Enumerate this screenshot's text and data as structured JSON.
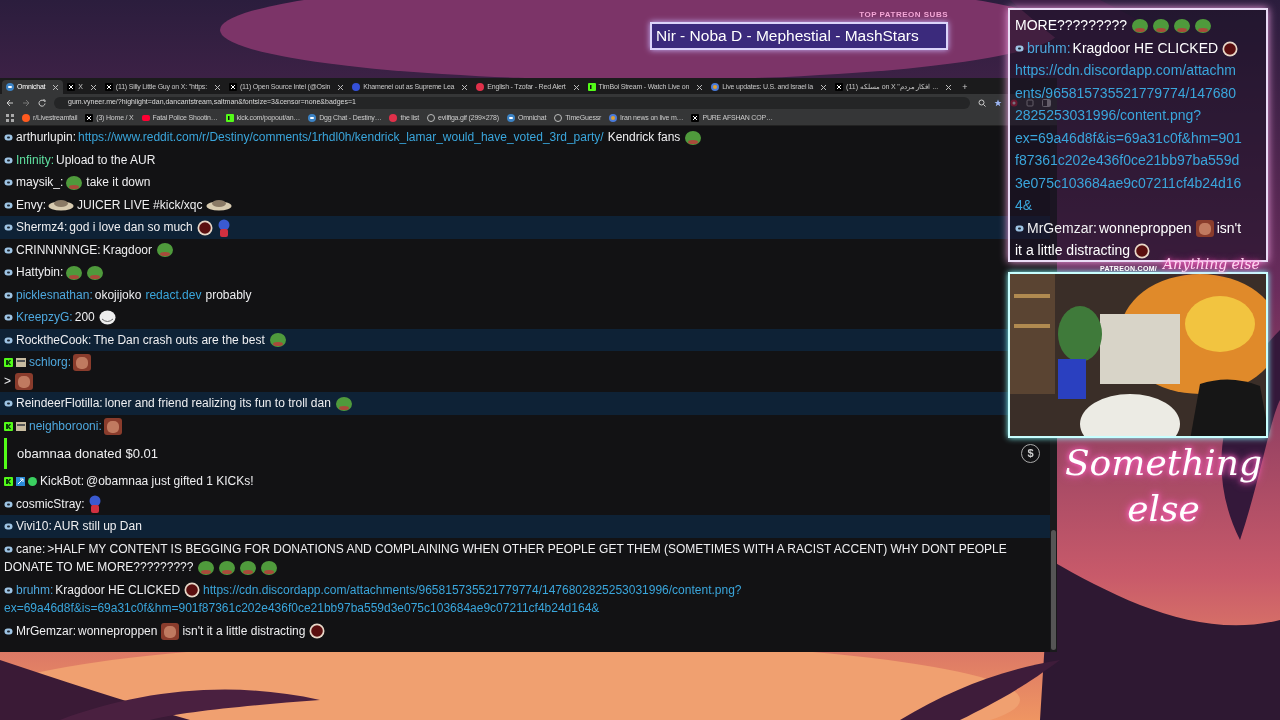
{
  "patreon_subs": {
    "label": "TOP PATREON SUBS",
    "names": "Nir - Noba D - Mephestial - MashStars"
  },
  "browser": {
    "tabs": [
      {
        "title": "Omnichat",
        "kind": "chat",
        "selected": true
      },
      {
        "title": "X",
        "kind": "x",
        "selected": false
      },
      {
        "title": "(11) Silly Little Guy on X: \"https:",
        "kind": "x",
        "selected": false
      },
      {
        "title": "(11) Open Source Intel (@Osin",
        "kind": "x",
        "selected": false
      },
      {
        "title": "Khamenei out as Supreme Lea",
        "kind": "circle",
        "selected": false
      },
      {
        "title": "English - Tzofar - Red Alert",
        "kind": "alert",
        "selected": false
      },
      {
        "title": "TimBoi Stream - Watch Live on",
        "kind": "kick",
        "selected": false
      },
      {
        "title": "Live updates: U.S. and Israel la",
        "kind": "news",
        "selected": false
      },
      {
        "title": "(11) مسلکه on X \"افکار مردم ...",
        "kind": "x",
        "selected": false
      }
    ],
    "new_tab": "+",
    "url": "gum.vyneer.me/?highlight=dan,dancantstream,saltman&fontsize=3&censor=none&badges=1",
    "bookmarks": [
      {
        "title": "r/Livestreamfail",
        "kind": "reddit"
      },
      {
        "title": "(3) Home / X",
        "kind": "x"
      },
      {
        "title": "Fatal Police Shootin…",
        "kind": "video"
      },
      {
        "title": "kick.com/popout/an…",
        "kind": "kick"
      },
      {
        "title": "Dgg Chat - Destiny…",
        "kind": "chat"
      },
      {
        "title": "the list",
        "kind": "alert"
      },
      {
        "title": "evilfiga.gif (299×278)",
        "kind": "globe"
      },
      {
        "title": "Omnichat",
        "kind": "chat"
      },
      {
        "title": "TimeGuessr",
        "kind": "globe"
      },
      {
        "title": "Iran news on live m…",
        "kind": "news"
      },
      {
        "title": "PURE AFSHAN COP…",
        "kind": "x"
      }
    ]
  },
  "chat": {
    "messages": [
      {
        "kind": "message",
        "badges": [
          {
            "kind": "chat"
          }
        ],
        "user": "arthurlupin:",
        "color": "#efeff1",
        "highlighted": false,
        "parts": [
          {
            "kind": "link",
            "text": "https://www.reddit.com/r/Destiny/comments/1rhdl0h/kendrick_lamar_would_have_voted_3rd_party/"
          },
          {
            "kind": "text",
            "text": "Kendrick fans"
          },
          {
            "kind": "frog"
          }
        ]
      },
      {
        "kind": "message",
        "badges": [
          {
            "kind": "chat"
          }
        ],
        "user": "Infinity:",
        "color": "#5fe0a0",
        "highlighted": false,
        "parts": [
          {
            "kind": "text",
            "text": "Upload to the AUR"
          }
        ]
      },
      {
        "kind": "message",
        "badges": [
          {
            "kind": "chat"
          }
        ],
        "user": "maysik_:",
        "color": "#efeff1",
        "highlighted": false,
        "parts": [
          {
            "kind": "frog"
          },
          {
            "kind": "text",
            "text": "take it down"
          }
        ]
      },
      {
        "kind": "message",
        "badges": [
          {
            "kind": "chat"
          }
        ],
        "user": "Envy:",
        "color": "#efeff1",
        "highlighted": false,
        "parts": [
          {
            "kind": "bowl"
          },
          {
            "kind": "text",
            "text": "JUICER LIVE #kick/xqc"
          },
          {
            "kind": "bowl"
          }
        ]
      },
      {
        "kind": "message",
        "badges": [
          {
            "kind": "chat"
          }
        ],
        "user": "Shermz4:",
        "color": "#efeff1",
        "highlighted": true,
        "parts": [
          {
            "kind": "text",
            "text": "god i love dan so much"
          },
          {
            "kind": "ball"
          },
          {
            "kind": "doll"
          }
        ]
      },
      {
        "kind": "message",
        "badges": [
          {
            "kind": "chat"
          }
        ],
        "user": "CRINNNNNGE:",
        "color": "#efeff1",
        "highlighted": false,
        "parts": [
          {
            "kind": "text",
            "text": "Kragdoor"
          },
          {
            "kind": "frog"
          }
        ]
      },
      {
        "kind": "message",
        "badges": [
          {
            "kind": "chat"
          }
        ],
        "user": "Hattybin:",
        "color": "#efeff1",
        "highlighted": false,
        "parts": [
          {
            "kind": "frog"
          },
          {
            "kind": "frog"
          }
        ]
      },
      {
        "kind": "message",
        "badges": [
          {
            "kind": "chat"
          }
        ],
        "user": "picklesnathan:",
        "color": "#4ea8de",
        "highlighted": false,
        "parts": [
          {
            "kind": "text",
            "text": "okojijoko"
          },
          {
            "kind": "link",
            "text": "redact.dev"
          },
          {
            "kind": "text",
            "text": "probably"
          }
        ]
      },
      {
        "kind": "message",
        "badges": [
          {
            "kind": "chat"
          }
        ],
        "user": "KreepzyG:",
        "color": "#4ea8de",
        "highlighted": false,
        "parts": [
          {
            "kind": "text",
            "text": "200"
          },
          {
            "kind": "troll"
          }
        ]
      },
      {
        "kind": "message",
        "badges": [
          {
            "kind": "chat"
          }
        ],
        "user": "RocktheCook:",
        "color": "#efeff1",
        "highlighted": true,
        "parts": [
          {
            "kind": "text",
            "text": "The Dan crash outs are the best"
          },
          {
            "kind": "frog"
          }
        ]
      },
      {
        "kind": "message",
        "badges": [
          {
            "kind": "kick"
          },
          {
            "kind": "sub"
          }
        ],
        "user": "schlorg:",
        "color": "#4ea8de",
        "highlighted": false,
        "parts": [
          {
            "kind": "face"
          },
          {
            "kind": "newline"
          },
          {
            "kind": "text",
            "text": ">"
          },
          {
            "kind": "face"
          }
        ]
      },
      {
        "kind": "message",
        "badges": [
          {
            "kind": "chat"
          }
        ],
        "user": "ReindeerFlotilla:",
        "color": "#efeff1",
        "highlighted": true,
        "parts": [
          {
            "kind": "text",
            "text": "loner and friend realizing its fun to troll dan"
          },
          {
            "kind": "frog"
          }
        ]
      },
      {
        "kind": "message",
        "badges": [
          {
            "kind": "kick"
          },
          {
            "kind": "sub"
          }
        ],
        "user": "neighborooni:",
        "color": "#4ea8de",
        "highlighted": false,
        "parts": [
          {
            "kind": "face"
          }
        ]
      },
      {
        "kind": "donation",
        "text": "obamnaa donated $0.01",
        "icon": "$"
      },
      {
        "kind": "message",
        "badges": [
          {
            "kind": "kick"
          },
          {
            "kind": "bot"
          },
          {
            "kind": "verified"
          }
        ],
        "user": "KickBot:",
        "color": "#efeff1",
        "highlighted": false,
        "parts": [
          {
            "kind": "text",
            "text": "@obamnaa just gifted 1 KICKs!"
          }
        ]
      },
      {
        "kind": "message",
        "badges": [
          {
            "kind": "chat"
          }
        ],
        "user": "cosmicStray:",
        "color": "#efeff1",
        "highlighted": false,
        "parts": [
          {
            "kind": "doll"
          }
        ]
      },
      {
        "kind": "message",
        "badges": [
          {
            "kind": "chat"
          }
        ],
        "user": "Vivi10:",
        "color": "#efeff1",
        "highlighted": true,
        "parts": [
          {
            "kind": "text",
            "text": "AUR still up Dan"
          }
        ]
      },
      {
        "kind": "message",
        "badges": [
          {
            "kind": "chat"
          }
        ],
        "user": "cane:",
        "color": "#efeff1",
        "highlighted": false,
        "parts": [
          {
            "kind": "text",
            "text": ">HALF MY CONTENT IS BEGGING FOR DONATIONS AND COMPLAINING WHEN OTHER PEOPLE GET THEM (SOMETIMES WITH A RACIST ACCENT) WHY DONT PEOPLE"
          },
          {
            "kind": "newline"
          },
          {
            "kind": "text",
            "text": "DONATE TO ME MORE?????????"
          },
          {
            "kind": "frog"
          },
          {
            "kind": "frog"
          },
          {
            "kind": "frog"
          },
          {
            "kind": "frog"
          }
        ]
      },
      {
        "kind": "message",
        "badges": [
          {
            "kind": "chat"
          }
        ],
        "user": "bruhm:",
        "color": "#4ea8de",
        "highlighted": false,
        "parts": [
          {
            "kind": "text",
            "text": "Kragdoor HE CLICKED"
          },
          {
            "kind": "ball"
          },
          {
            "kind": "link",
            "text": "https://cdn.discordapp.com/attachments/965815735521779774/1476802825253031996/content.png?"
          },
          {
            "kind": "newline"
          },
          {
            "kind": "link",
            "text": "ex=69a46d8f&is=69a31c0f&hm=901f87361c202e436f0ce21bb97ba559d3e075c103684ae9c07211cf4b24d164&"
          }
        ]
      },
      {
        "kind": "message",
        "badges": [
          {
            "kind": "chat"
          }
        ],
        "user": "MrGemzar:",
        "color": "#efeff1",
        "highlighted": false,
        "parts": [
          {
            "kind": "text",
            "text": "wonneproppen"
          },
          {
            "kind": "face"
          },
          {
            "kind": "text",
            "text": "isn't it a little distracting"
          },
          {
            "kind": "ball"
          }
        ]
      }
    ]
  },
  "overlay_chat": {
    "messages": [
      {
        "kind": "message",
        "parts": [
          {
            "kind": "text",
            "text": "MORE?????????"
          },
          {
            "kind": "frog"
          },
          {
            "kind": "frog"
          },
          {
            "kind": "frog"
          },
          {
            "kind": "frog"
          }
        ]
      },
      {
        "kind": "message",
        "badges": [
          {
            "kind": "chat"
          }
        ],
        "user": "bruhm:",
        "color": "#4ea8de",
        "parts": [
          {
            "kind": "text",
            "text": "Kragdoor HE CLICKED"
          },
          {
            "kind": "ball"
          },
          {
            "kind": "newline"
          },
          {
            "kind": "link",
            "text": "https://cdn.discordapp.com/attachm"
          },
          {
            "kind": "newline"
          },
          {
            "kind": "link",
            "text": "ents/965815735521779774/147680"
          },
          {
            "kind": "newline"
          },
          {
            "kind": "link",
            "text": "2825253031996/content.png?"
          },
          {
            "kind": "newline"
          },
          {
            "kind": "link",
            "text": "ex=69a46d8f&is=69a31c0f&hm=901"
          },
          {
            "kind": "newline"
          },
          {
            "kind": "link",
            "text": "f87361c202e436f0ce21bb97ba559d"
          },
          {
            "kind": "newline"
          },
          {
            "kind": "link",
            "text": "3e075c103684ae9c07211cf4b24d16"
          },
          {
            "kind": "newline"
          },
          {
            "kind": "link",
            "text": "4&"
          }
        ]
      },
      {
        "kind": "message",
        "badges": [
          {
            "kind": "chat"
          }
        ],
        "user": "MrGemzar:",
        "color": "#efeff1",
        "parts": [
          {
            "kind": "text",
            "text": "wonneproppen"
          },
          {
            "kind": "face"
          },
          {
            "kind": "text",
            "text": "isn't"
          },
          {
            "kind": "newline"
          },
          {
            "kind": "text",
            "text": "it a little distracting"
          },
          {
            "kind": "ball"
          }
        ]
      }
    ]
  },
  "webcam": {
    "caption_url": "PATREON.COM/",
    "caption_logo": "Anything else"
  },
  "logo": "Something else"
}
